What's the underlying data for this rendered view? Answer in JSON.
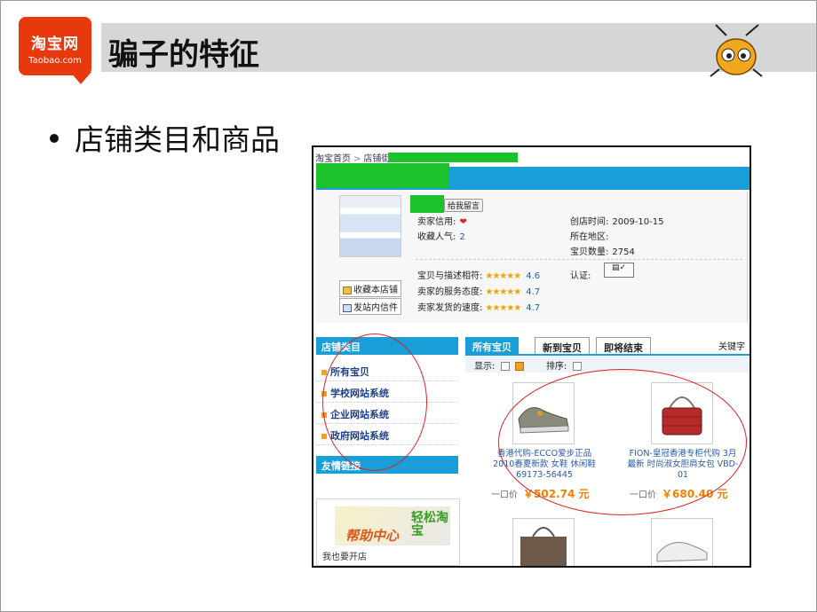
{
  "logo": {
    "main": "淘宝网",
    "sub": "Taobao.com"
  },
  "title": "骗子的特征",
  "bullet": "店铺类目和商品",
  "shop": {
    "breadcrumb": [
      "淘宝首页",
      "店铺街"
    ],
    "leave_msg": "给我留言",
    "seller_credit_label": "卖家信用:",
    "favorites_label": "收藏人气:",
    "favorites_value": "2",
    "created_label": "创店时间:",
    "created_value": "2009-10-15",
    "region_label": "所在地区:",
    "items_label": "宝贝数量:",
    "items_value": "2754",
    "ratings": [
      {
        "label": "宝贝与描述相符:",
        "stars": "★★★★★",
        "value": "4.6"
      },
      {
        "label": "卖家的服务态度:",
        "stars": "★★★★★",
        "value": "4.7"
      },
      {
        "label": "卖家发货的速度:",
        "stars": "★★★★★",
        "value": "4.7"
      }
    ],
    "cert_label": "认证:",
    "collect_btn": "收藏本店铺",
    "mail_btn": "发站内信件",
    "category_head": "店铺类目",
    "categories": [
      "所有宝贝",
      "学校网站系统",
      "企业网站系统",
      "政府网站系统"
    ],
    "friend_head": "友情链接",
    "help_text": "帮助中心",
    "help_text2": "轻松淘宝",
    "open_shop": "我也要开店",
    "tabs": [
      "所有宝贝",
      "新到宝贝",
      "即将结束"
    ],
    "keyword": "关键字",
    "show_label": "显示:",
    "sort_label": "排序:",
    "products": [
      {
        "title": "香港代购-ECCO爱步正品 2010春夏新款 女鞋 休闲鞋 69173-56445",
        "price_label": "一口价",
        "price": "￥502.74 元"
      },
      {
        "title": "FION-皇冠香港专柜代购 3月最新 时尚淑女胆肩女包 VBD-01",
        "price_label": "一口价",
        "price": "￥680.40 元"
      }
    ]
  },
  "colors": {
    "accent": "#1a9ed7",
    "mask": "#1bc22b",
    "oval": "#dd2222",
    "logo": "#e8380d"
  }
}
